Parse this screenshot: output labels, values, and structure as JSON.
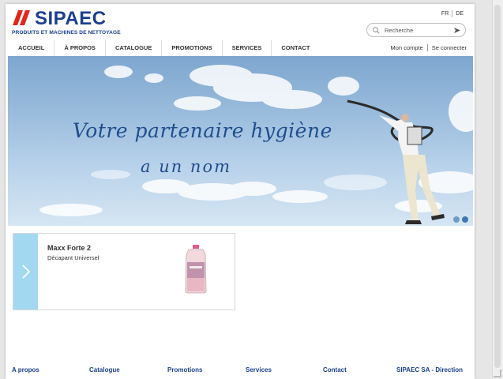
{
  "brand": {
    "name": "SIPAEC",
    "tagline": "PRODUITS ET MACHINES DE NETTOYAGE",
    "color": "#1b3f8f"
  },
  "languages": [
    "FR",
    "DE"
  ],
  "search": {
    "placeholder": "Recherche"
  },
  "nav": {
    "items": [
      {
        "label": "ACCUEIL"
      },
      {
        "label": "À PROPOS"
      },
      {
        "label": "CATALOGUE"
      },
      {
        "label": "PROMOTIONS"
      },
      {
        "label": "SERVICES"
      },
      {
        "label": "CONTACT"
      }
    ]
  },
  "account": {
    "my_account": "Mon compte",
    "login": "Se connecter"
  },
  "hero": {
    "line1": "Votre partenaire hygiène",
    "line2": "a un nom",
    "slide_count": 2,
    "active_slide": 2
  },
  "product": {
    "name": "Maxx Forte 2",
    "description": "Décapant Universel"
  },
  "footer": {
    "links": [
      "A propos",
      "Catalogue",
      "Promotions",
      "Services",
      "Contact",
      "SIPAEC SA - Direction"
    ]
  }
}
